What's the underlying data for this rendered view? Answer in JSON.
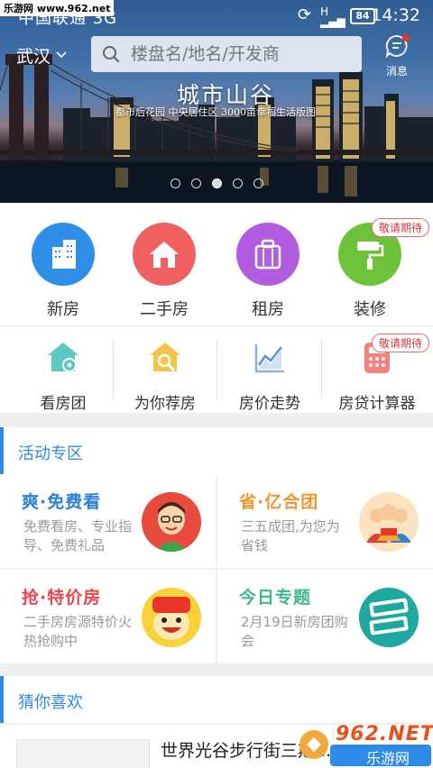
{
  "status_bar": {
    "carrier": "中国联通 3G",
    "battery": "84",
    "time": "14:32"
  },
  "watermark_top": "乐游网 www.962.net",
  "header": {
    "city": "武汉",
    "search_placeholder": "楼盘名/地名/开发商",
    "message_label": "消息"
  },
  "banner": {
    "title": "城市山谷",
    "subtitle": "都市后花园  中央居住区  3000亩幸福生活版图",
    "slide_count": 5,
    "active_slide": 3
  },
  "categories": [
    {
      "label": "新房",
      "color": "#2f8ee8",
      "icon": "building-icon"
    },
    {
      "label": "二手房",
      "color": "#f06060",
      "icon": "house-icon"
    },
    {
      "label": "租房",
      "color": "#b25de0",
      "icon": "suitcase-icon"
    },
    {
      "label": "装修",
      "color": "#6cc33a",
      "icon": "paint-roller-icon",
      "badge": "敬请期待"
    }
  ],
  "tools": [
    {
      "label": "看房团",
      "icon": "house-tour-icon"
    },
    {
      "label": "为你荐房",
      "icon": "house-search-icon"
    },
    {
      "label": "房价走势",
      "icon": "trend-chart-icon"
    },
    {
      "label": "房贷计算器",
      "icon": "calculator-icon",
      "badge": "敬请期待"
    }
  ],
  "activity": {
    "title": "活动专区",
    "items": [
      {
        "title": "爽·免费看",
        "desc": "免费看房、专业指导、免费礼品",
        "title_color": "#2a7fd6"
      },
      {
        "title": "省·亿合团",
        "desc": "三五成团,为您为省钱",
        "title_color": "#f0962e"
      },
      {
        "title": "抢·特价房",
        "desc": "二手房房源特价火热抢购中",
        "title_color": "#e8464e"
      },
      {
        "title": "今日专题",
        "desc": "2月19日新房团购会",
        "title_color": "#3fb88a"
      }
    ]
  },
  "guess": {
    "title": "猜你喜欢",
    "items": [
      {
        "title": "世界光谷步行街三期..."
      }
    ]
  },
  "watermark_bottom": {
    "brand": "962.NET",
    "sub": "乐游网"
  }
}
